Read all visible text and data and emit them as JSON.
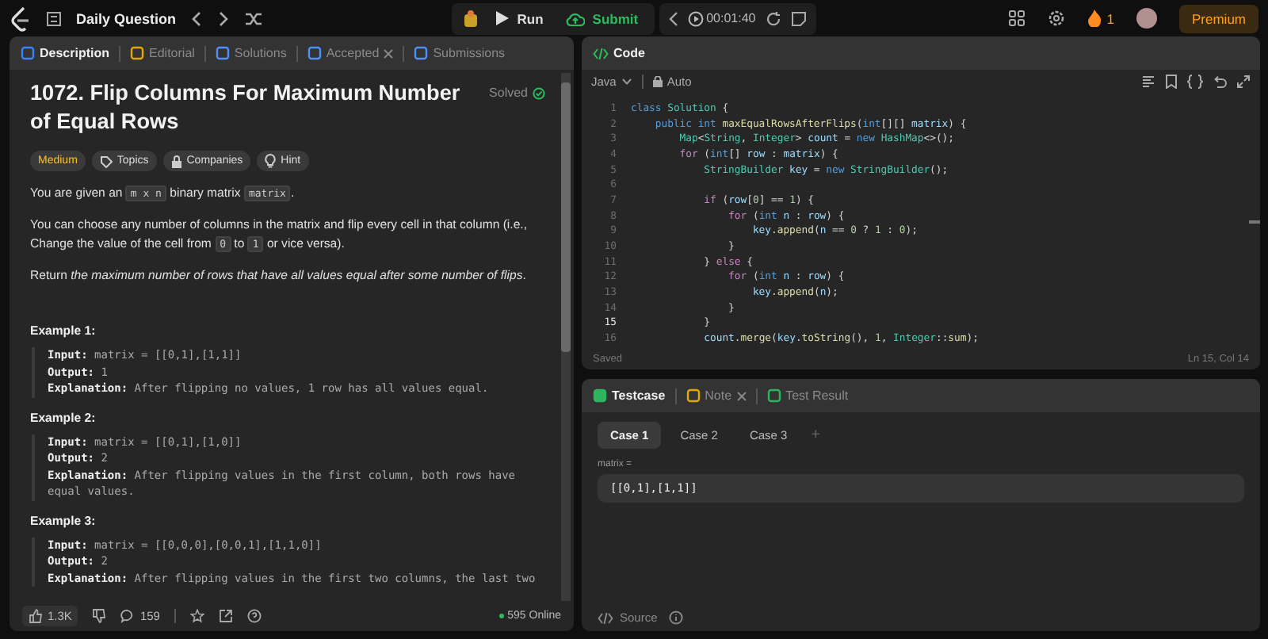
{
  "topbar": {
    "title": "Daily Question",
    "run": "Run",
    "submit": "Submit",
    "timer": "00:01:40",
    "streak": "1",
    "premium": "Premium"
  },
  "description_panel": {
    "tabs": [
      {
        "label": "Description",
        "selected": true,
        "closable": false
      },
      {
        "label": "Editorial",
        "selected": false,
        "closable": false
      },
      {
        "label": "Solutions",
        "selected": false,
        "closable": false
      },
      {
        "label": "Accepted",
        "selected": false,
        "closable": true
      },
      {
        "label": "Submissions",
        "selected": false,
        "closable": false
      }
    ],
    "title": "1072. Flip Columns For Maximum Number of Equal Rows",
    "status": "Solved",
    "difficulty": "Medium",
    "tags": [
      "Topics",
      "Companies",
      "Hint"
    ],
    "paragraphs": [
      [
        {
          "kind": "text",
          "text": "You are given an "
        },
        {
          "kind": "code",
          "text": "m x n"
        },
        {
          "kind": "text",
          "text": " binary matrix "
        },
        {
          "kind": "code",
          "text": "matrix"
        },
        {
          "kind": "text",
          "text": "."
        }
      ],
      [
        {
          "kind": "text",
          "text": "You can choose any number of columns in the matrix and flip every cell in that column (i.e., Change the value of the cell from "
        },
        {
          "kind": "code",
          "text": "0"
        },
        {
          "kind": "text",
          "text": " to "
        },
        {
          "kind": "code",
          "text": "1"
        },
        {
          "kind": "text",
          "text": " or vice versa)."
        }
      ],
      [
        {
          "kind": "text",
          "text": "Return *the maximum number of rows that have all values equal after some number of flips*."
        }
      ]
    ],
    "examples": [
      {
        "title": "Example 1:",
        "lines": [
          {
            "label": "Input:",
            "value": "matrix = [[0,1],[1,1]]"
          },
          {
            "label": "Output:",
            "value": "1"
          },
          {
            "label": "Explanation:",
            "value": "After flipping no values, 1 row has all values equal."
          }
        ]
      },
      {
        "title": "Example 2:",
        "lines": [
          {
            "label": "Input:",
            "value": "matrix = [[0,1],[1,0]]"
          },
          {
            "label": "Output:",
            "value": "2"
          },
          {
            "label": "Explanation:",
            "value": "After flipping values in the first column, both rows have equal values."
          }
        ]
      },
      {
        "title": "Example 3:",
        "lines": [
          {
            "label": "Input:",
            "value": "matrix = [[0,0,0],[0,0,1],[1,1,0]]"
          },
          {
            "label": "Output:",
            "value": "2"
          },
          {
            "label": "Explanation:",
            "value": "After flipping values in the first two columns, the last two"
          }
        ]
      }
    ],
    "footer": {
      "likes": "1.3K",
      "comments": "159",
      "online": "595 Online"
    }
  },
  "code_panel": {
    "title": "Code",
    "language": "Java",
    "mode": "Auto",
    "status": "Saved",
    "cursor": "Ln 15, Col 14",
    "lines": [
      {
        "number": "1",
        "current": false,
        "tokens": [
          {
            "kind": "kw",
            "text": "class"
          },
          {
            "kind": "type",
            "text": " Solution"
          },
          {
            "kind": "p",
            "text": " {"
          }
        ]
      },
      {
        "number": "2",
        "current": false,
        "tokens": [
          {
            "kind": "kw",
            "text": "    public"
          },
          {
            "kind": "kw",
            "text": " int"
          },
          {
            "kind": "fn",
            "text": " maxEqualRowsAfterFlips"
          },
          {
            "kind": "p",
            "text": "("
          },
          {
            "kind": "kw",
            "text": "int"
          },
          {
            "kind": "p",
            "text": "[][] "
          },
          {
            "kind": "var",
            "text": "matrix"
          },
          {
            "kind": "p",
            "text": ") {"
          }
        ]
      },
      {
        "number": "3",
        "current": false,
        "tokens": [
          {
            "kind": "type",
            "text": "        Map"
          },
          {
            "kind": "p",
            "text": "<"
          },
          {
            "kind": "type",
            "text": "String"
          },
          {
            "kind": "p",
            "text": ", "
          },
          {
            "kind": "type",
            "text": "Integer"
          },
          {
            "kind": "p",
            "text": "> "
          },
          {
            "kind": "var",
            "text": "count"
          },
          {
            "kind": "p",
            "text": " = "
          },
          {
            "kind": "kw",
            "text": "new"
          },
          {
            "kind": "type",
            "text": " HashMap"
          },
          {
            "kind": "p",
            "text": "<>();"
          }
        ]
      },
      {
        "number": "4",
        "current": false,
        "tokens": [
          {
            "kind": "ctl",
            "text": "        for"
          },
          {
            "kind": "p",
            "text": " ("
          },
          {
            "kind": "kw",
            "text": "int"
          },
          {
            "kind": "p",
            "text": "[] "
          },
          {
            "kind": "var",
            "text": "row"
          },
          {
            "kind": "p",
            "text": " : "
          },
          {
            "kind": "var",
            "text": "matrix"
          },
          {
            "kind": "p",
            "text": ") {"
          }
        ]
      },
      {
        "number": "5",
        "current": false,
        "tokens": [
          {
            "kind": "type",
            "text": "            StringBuilder"
          },
          {
            "kind": "var",
            "text": " key"
          },
          {
            "kind": "p",
            "text": " = "
          },
          {
            "kind": "kw",
            "text": "new"
          },
          {
            "kind": "type",
            "text": " StringBuilder"
          },
          {
            "kind": "p",
            "text": "();"
          }
        ]
      },
      {
        "number": "6",
        "current": false
      },
      {
        "number": "7",
        "current": false,
        "tokens": [
          {
            "kind": "ctl",
            "text": "            if"
          },
          {
            "kind": "p",
            "text": " ("
          },
          {
            "kind": "var",
            "text": "row"
          },
          {
            "kind": "p",
            "text": "["
          },
          {
            "kind": "num",
            "text": "0"
          },
          {
            "kind": "p",
            "text": "] == "
          },
          {
            "kind": "num",
            "text": "1"
          },
          {
            "kind": "p",
            "text": ") {"
          }
        ]
      },
      {
        "number": "8",
        "current": false,
        "tokens": [
          {
            "kind": "ctl",
            "text": "                for"
          },
          {
            "kind": "p",
            "text": " ("
          },
          {
            "kind": "kw",
            "text": "int"
          },
          {
            "kind": "var",
            "text": " n"
          },
          {
            "kind": "p",
            "text": " : "
          },
          {
            "kind": "var",
            "text": "row"
          },
          {
            "kind": "p",
            "text": ") {"
          }
        ]
      },
      {
        "number": "9",
        "current": false,
        "tokens": [
          {
            "kind": "var",
            "text": "                    key"
          },
          {
            "kind": "p",
            "text": "."
          },
          {
            "kind": "fn",
            "text": "append"
          },
          {
            "kind": "p",
            "text": "("
          },
          {
            "kind": "var",
            "text": "n"
          },
          {
            "kind": "p",
            "text": " == "
          },
          {
            "kind": "num",
            "text": "0"
          },
          {
            "kind": "p",
            "text": " ? "
          },
          {
            "kind": "num",
            "text": "1"
          },
          {
            "kind": "p",
            "text": " : "
          },
          {
            "kind": "num",
            "text": "0"
          },
          {
            "kind": "p",
            "text": ");"
          }
        ]
      },
      {
        "number": "10",
        "current": false,
        "tokens": [
          {
            "kind": "p",
            "text": "                }"
          }
        ]
      },
      {
        "number": "11",
        "current": false,
        "tokens": [
          {
            "kind": "p",
            "text": "            } "
          },
          {
            "kind": "ctl",
            "text": "else"
          },
          {
            "kind": "p",
            "text": " {"
          }
        ]
      },
      {
        "number": "12",
        "current": false,
        "tokens": [
          {
            "kind": "ctl",
            "text": "                for"
          },
          {
            "kind": "p",
            "text": " ("
          },
          {
            "kind": "kw",
            "text": "int"
          },
          {
            "kind": "var",
            "text": " n"
          },
          {
            "kind": "p",
            "text": " : "
          },
          {
            "kind": "var",
            "text": "row"
          },
          {
            "kind": "p",
            "text": ") {"
          }
        ]
      },
      {
        "number": "13",
        "current": false,
        "tokens": [
          {
            "kind": "var",
            "text": "                    key"
          },
          {
            "kind": "p",
            "text": "."
          },
          {
            "kind": "fn",
            "text": "append"
          },
          {
            "kind": "p",
            "text": "("
          },
          {
            "kind": "var",
            "text": "n"
          },
          {
            "kind": "p",
            "text": ");"
          }
        ]
      },
      {
        "number": "14",
        "current": false,
        "tokens": [
          {
            "kind": "p",
            "text": "                }"
          }
        ]
      },
      {
        "number": "15",
        "current": true,
        "tokens": [
          {
            "kind": "p",
            "text": "            }"
          }
        ]
      },
      {
        "number": "16",
        "current": false,
        "tokens": [
          {
            "kind": "var",
            "text": "            count"
          },
          {
            "kind": "p",
            "text": "."
          },
          {
            "kind": "fn",
            "text": "merge"
          },
          {
            "kind": "p",
            "text": "("
          },
          {
            "kind": "var",
            "text": "key"
          },
          {
            "kind": "p",
            "text": "."
          },
          {
            "kind": "fn",
            "text": "toString"
          },
          {
            "kind": "p",
            "text": "(), "
          },
          {
            "kind": "num",
            "text": "1"
          },
          {
            "kind": "p",
            "text": ", "
          },
          {
            "kind": "type",
            "text": "Integer"
          },
          {
            "kind": "p",
            "text": "::"
          },
          {
            "kind": "fn",
            "text": "sum"
          },
          {
            "kind": "p",
            "text": ");"
          }
        ]
      }
    ]
  },
  "console_panel": {
    "tabs": [
      {
        "label": "Testcase",
        "selected": true,
        "closable": false
      },
      {
        "label": "Note",
        "selected": false,
        "closable": true
      },
      {
        "label": "Test Result",
        "selected": false,
        "closable": false
      }
    ],
    "cases": [
      {
        "label": "Case 1",
        "selected": true
      },
      {
        "label": "Case 2",
        "selected": false
      },
      {
        "label": "Case 3",
        "selected": false
      }
    ],
    "add_case": "+",
    "param_label": "matrix =",
    "param_value": "[[0,1],[1,1]]",
    "source": "Source"
  }
}
